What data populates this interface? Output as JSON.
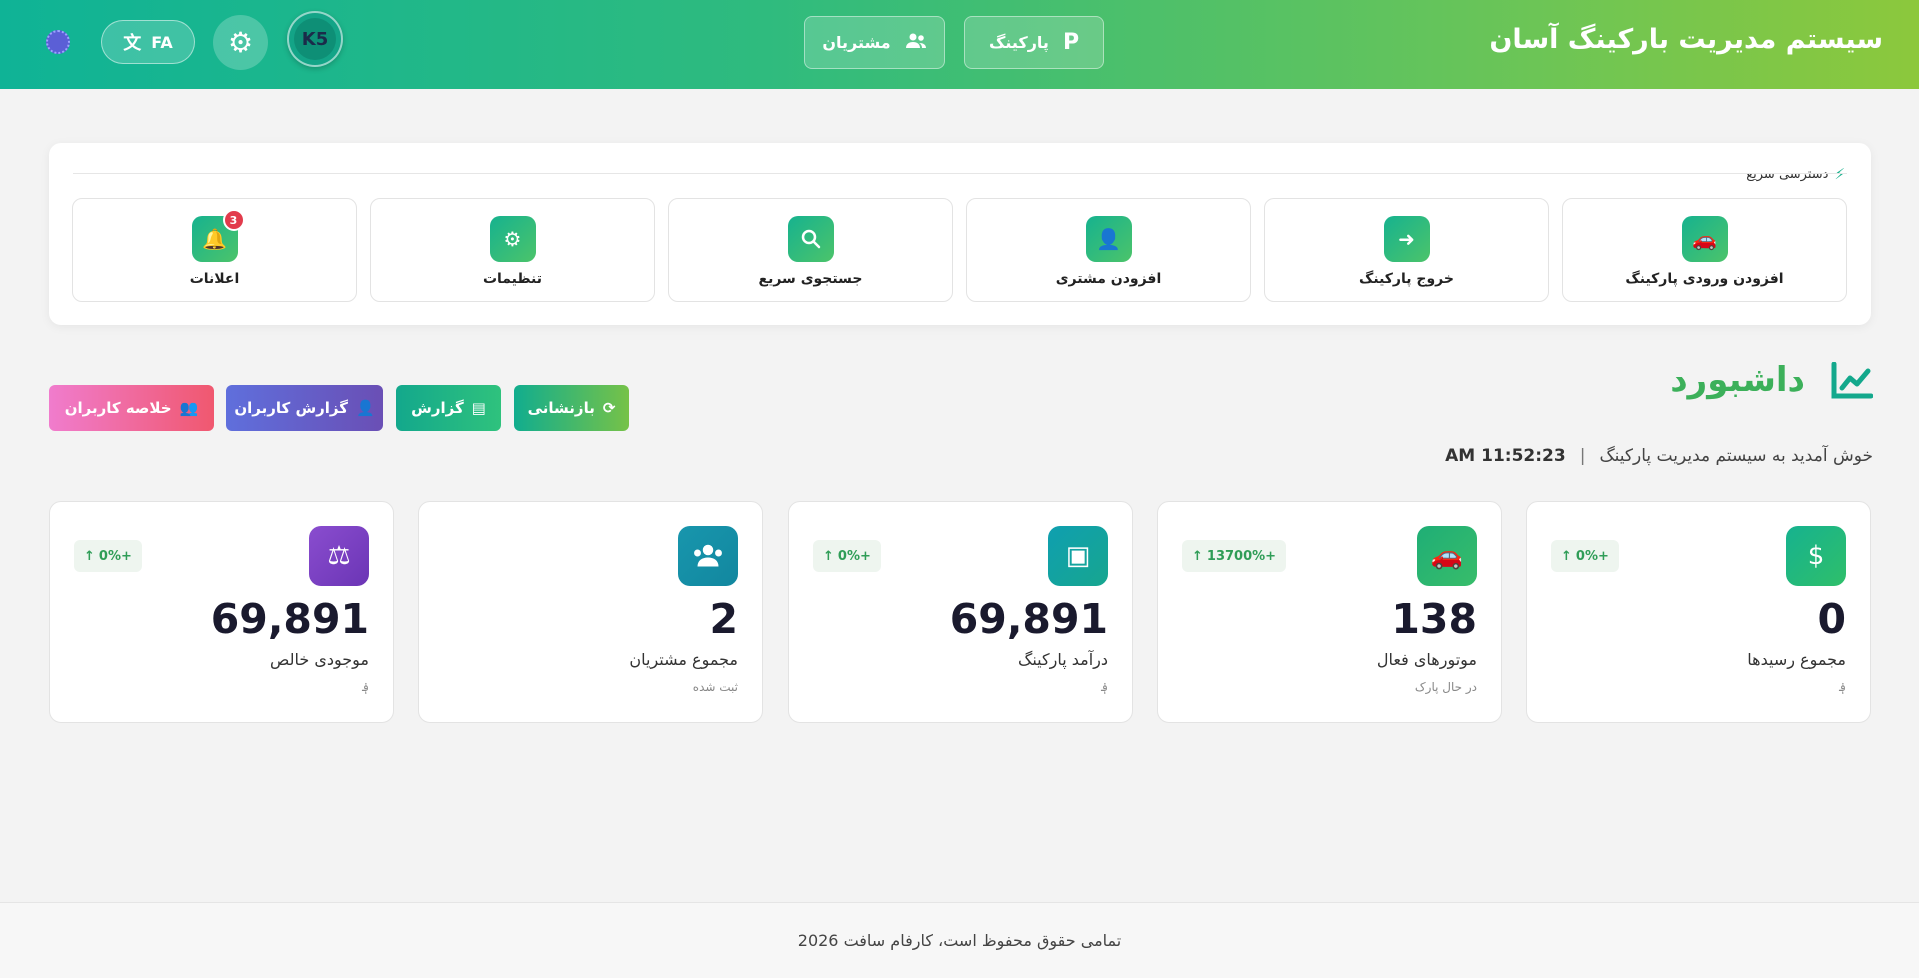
{
  "header": {
    "app_title": "سیستم مدیریت بارکینگ آسان",
    "nav": [
      {
        "label": "پارکینگ",
        "icon": "parking-p-icon"
      },
      {
        "label": "مشتریان",
        "icon": "users-icon"
      }
    ],
    "avatar_text": "K5",
    "language_label": "FA"
  },
  "quick_access": {
    "title": "دسترسی سریع",
    "items": [
      {
        "label": "افزودن ورودی پارکینگ",
        "icon": "car-icon"
      },
      {
        "label": "خروج پارکینگ",
        "icon": "exit-icon"
      },
      {
        "label": "افزودن مشتری",
        "icon": "user-plus-icon"
      },
      {
        "label": "جستجوی سریع",
        "icon": "search-icon"
      },
      {
        "label": "تنظیمات",
        "icon": "gear-icon"
      },
      {
        "label": "اعلانات",
        "icon": "bell-icon",
        "badge": "3"
      }
    ]
  },
  "dashboard": {
    "title": "داشبورد",
    "welcome": "خوش آمدید به سیستم مدیریت پارکینگ",
    "time": "AM 11:52:23",
    "separator": "|",
    "actions": [
      {
        "label": "بازنشانی",
        "icon": "refresh-icon"
      },
      {
        "label": "گزارش",
        "icon": "chart-icon"
      },
      {
        "label": "گزارش کاربران",
        "icon": "user-check-icon"
      },
      {
        "label": "خلاصه کاربران",
        "icon": "users-group-icon"
      }
    ]
  },
  "stats": [
    {
      "label": "مجموع رسیدها",
      "value": "0",
      "sub": "؋",
      "trend": "0%+",
      "icon": "hand-money-icon",
      "color": "#1fb36d"
    },
    {
      "label": "موتورهای فعال",
      "value": "138",
      "sub": "در حال پارک",
      "trend": "13700%+",
      "icon": "car-icon",
      "color": "#27b46b"
    },
    {
      "label": "درآمد پارکینگ",
      "value": "69,891",
      "sub": "؋",
      "trend": "0%+",
      "icon": "money-bill-icon",
      "color": "#13a2a6"
    },
    {
      "label": "مجموع مشتریان",
      "value": "2",
      "sub": "ثبت شده",
      "trend": "",
      "icon": "users-icon",
      "color": "#1694ad"
    },
    {
      "label": "موجودی خالص",
      "value": "69,891",
      "sub": "؋",
      "trend": "0%+",
      "icon": "scale-icon",
      "color": "#7b3fc4"
    }
  ],
  "footer": {
    "text": "تمامی حقوق محفوظ است، کارفام سافت 2026"
  }
}
